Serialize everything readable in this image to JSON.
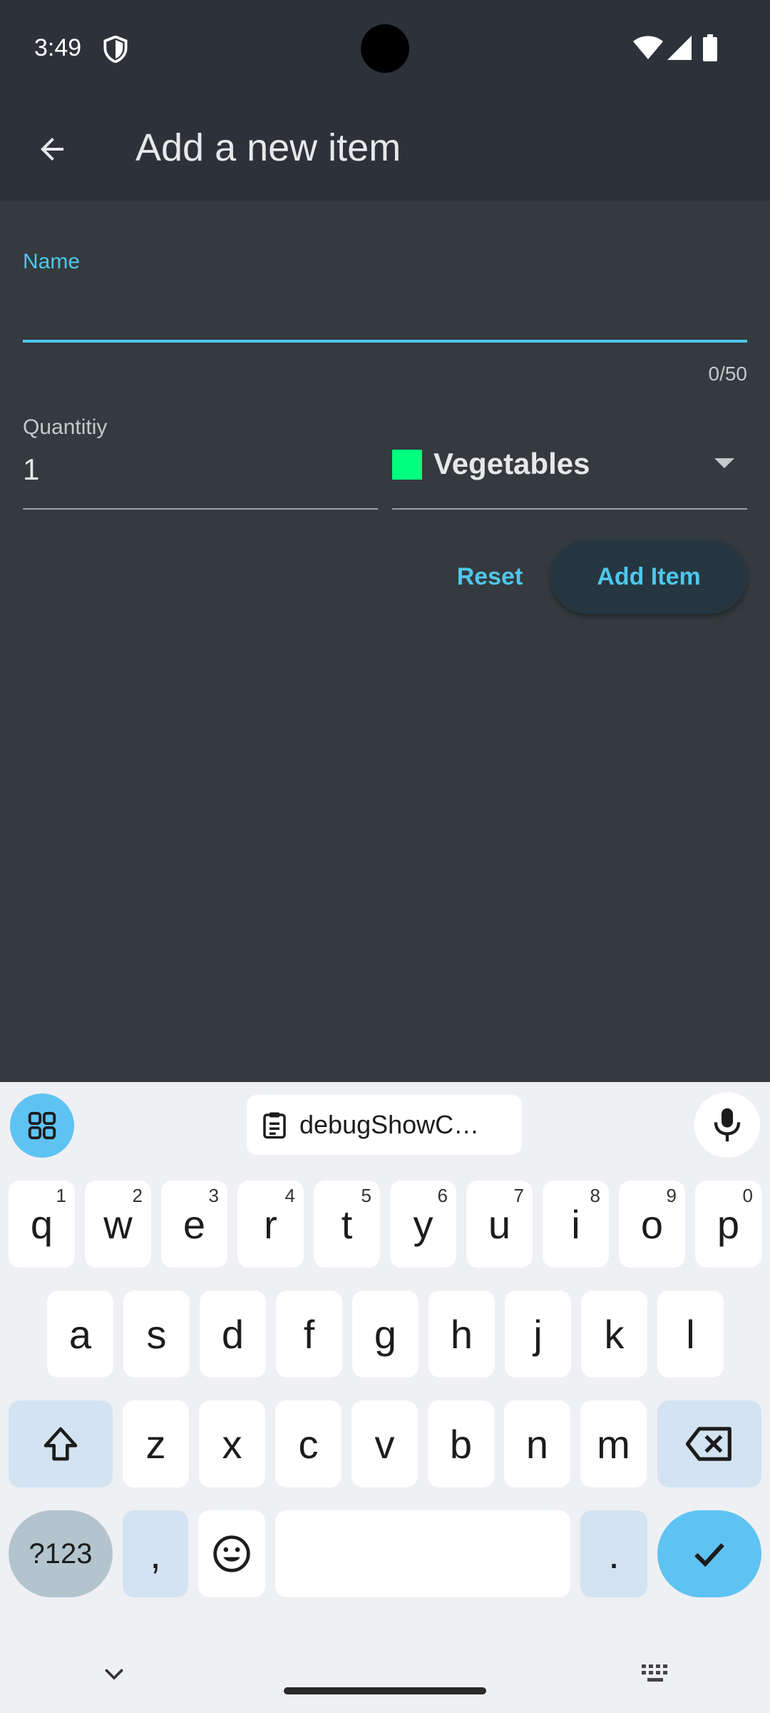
{
  "status_bar": {
    "time": "3:49"
  },
  "app_bar": {
    "title": "Add a new item"
  },
  "form": {
    "name_label": "Name",
    "name_value": "",
    "name_counter": "0/50",
    "quantity_label": "Quantitiy",
    "quantity_value": "1",
    "category_label": "Vegetables",
    "category_color": "#00ff7f",
    "reset_label": "Reset",
    "add_label": "Add Item"
  },
  "keyboard": {
    "clipboard_text": "debugShowC…",
    "row1": [
      {
        "k": "q",
        "h": "1"
      },
      {
        "k": "w",
        "h": "2"
      },
      {
        "k": "e",
        "h": "3"
      },
      {
        "k": "r",
        "h": "4"
      },
      {
        "k": "t",
        "h": "5"
      },
      {
        "k": "y",
        "h": "6"
      },
      {
        "k": "u",
        "h": "7"
      },
      {
        "k": "i",
        "h": "8"
      },
      {
        "k": "o",
        "h": "9"
      },
      {
        "k": "p",
        "h": "0"
      }
    ],
    "row2": [
      "a",
      "s",
      "d",
      "f",
      "g",
      "h",
      "j",
      "k",
      "l"
    ],
    "row3": [
      "z",
      "x",
      "c",
      "v",
      "b",
      "n",
      "m"
    ],
    "symbols_label": "?123",
    "comma_label": ",",
    "period_label": "."
  },
  "colors": {
    "accent": "#4fc6ea",
    "app_bar": "#2d323a",
    "background": "#343a3d"
  }
}
